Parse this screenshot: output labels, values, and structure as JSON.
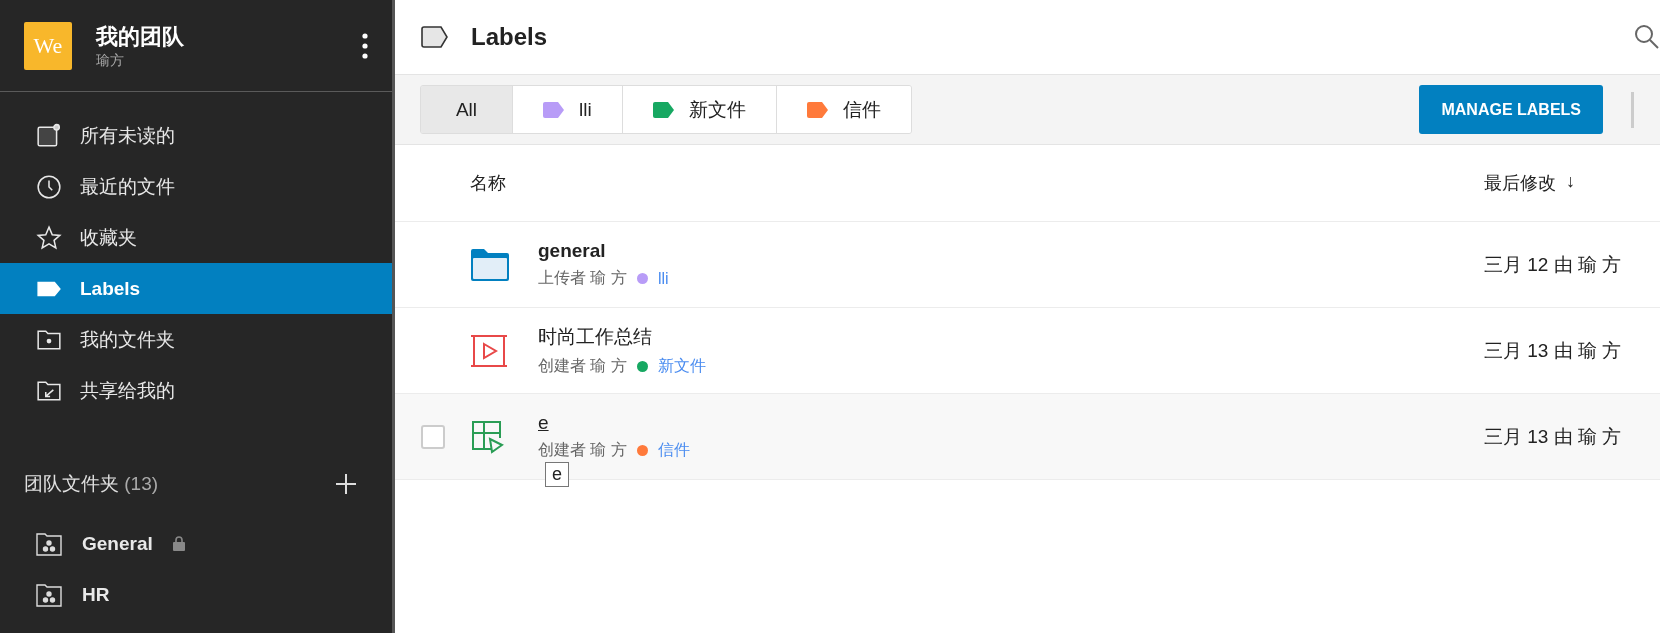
{
  "team": {
    "logo": "We",
    "name": "我的团队",
    "user": "瑜方"
  },
  "nav": [
    {
      "label": "所有未读的",
      "kind": "unread",
      "selected": false
    },
    {
      "label": "最近的文件",
      "kind": "recent",
      "selected": false
    },
    {
      "label": "收藏夹",
      "kind": "favorites",
      "selected": false
    },
    {
      "label": "Labels",
      "kind": "labels",
      "selected": true
    },
    {
      "label": "我的文件夹",
      "kind": "mine",
      "selected": false
    },
    {
      "label": "共享给我的",
      "kind": "shared",
      "selected": false
    }
  ],
  "team_folders": {
    "title": "团队文件夹",
    "count": "(13)",
    "items": [
      {
        "label": "General",
        "locked": true
      },
      {
        "label": "HR",
        "locked": false
      }
    ]
  },
  "page": {
    "title": "Labels"
  },
  "filters": [
    {
      "label": "All",
      "selected": true
    },
    {
      "label": "lli",
      "color": "#b89cf7",
      "selected": false
    },
    {
      "label": "新文件",
      "color": "#17a862",
      "selected": false
    },
    {
      "label": "信件",
      "color": "#ff7a3b",
      "selected": false
    }
  ],
  "manage_button": "MANAGE LABELS",
  "table": {
    "columns": [
      "名称",
      "最后修改"
    ],
    "sort_arrow": "↓",
    "rows": [
      {
        "kind": "folder",
        "name": "general",
        "meta": "上传者 瑜 方",
        "label": "lli",
        "color": "#b89cf7",
        "modified": "三月 12 由 瑜 方",
        "hovered": false
      },
      {
        "kind": "video",
        "name": "时尚工作总结",
        "meta": "创建者 瑜 方",
        "label": "新文件",
        "color": "#17a862",
        "modified": "三月 13 由 瑜 方",
        "hovered": false
      },
      {
        "kind": "sheet",
        "name": "e",
        "meta": "创建者 瑜 方",
        "label": "信件",
        "color": "#ff7a3b",
        "modified": "三月 13 由 瑜 方",
        "hovered": true,
        "checked": false,
        "tooltip": "e"
      }
    ]
  }
}
